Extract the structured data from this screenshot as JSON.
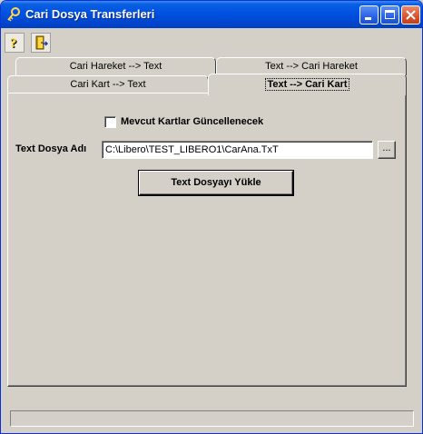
{
  "window": {
    "title": "Cari Dosya Transferleri",
    "controls": [
      "minimize-icon",
      "maximize-icon",
      "close-icon"
    ]
  },
  "toolbar": {
    "buttons": [
      {
        "icon": "help-icon"
      },
      {
        "icon": "exit-door-icon"
      }
    ]
  },
  "tabs": {
    "back_row": [
      {
        "label": "Cari Hareket --> Text"
      },
      {
        "label": "Text --> Cari Hareket"
      }
    ],
    "front_row": [
      {
        "label": "Cari Kart --> Text"
      },
      {
        "label": "Text --> Cari Kart",
        "active": true
      }
    ]
  },
  "form": {
    "checkbox_label": "Mevcut Kartlar Güncellenecek",
    "checkbox_checked": false,
    "file_label": "Text Dosya Adı",
    "file_value": "C:\\Libero\\TEST_LIBERO1\\CarAna.TxT",
    "browse_label": "...",
    "load_button": "Text Dosyayı Yükle"
  },
  "statusbar": {
    "text": ""
  }
}
